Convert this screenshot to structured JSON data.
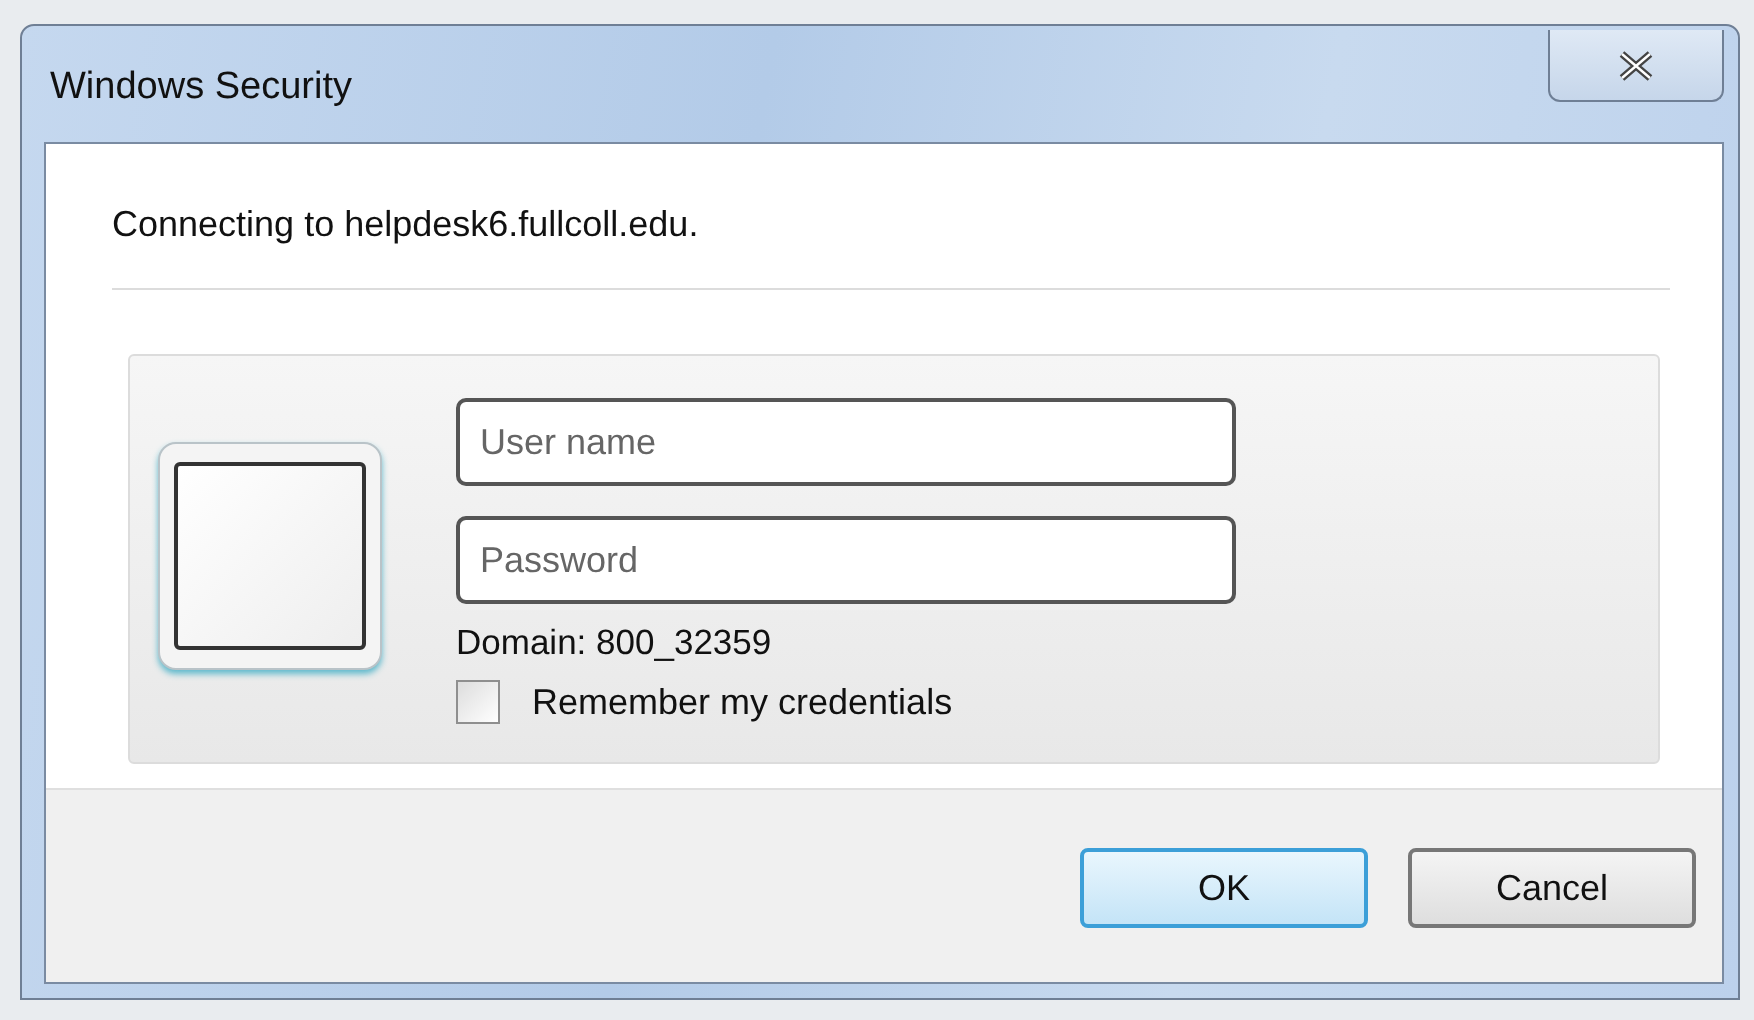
{
  "window": {
    "title": "Windows Security"
  },
  "message": "Connecting to helpdesk6.fullcoll.edu.",
  "credentials": {
    "fields": [
      {
        "placeholder": "User name"
      },
      {
        "placeholder": "Password"
      }
    ],
    "domain": "Domain: 800_32359",
    "remember": {
      "label": "Remember my credentials",
      "checked": false
    }
  },
  "buttons": [
    {
      "label": "OK",
      "default": true
    },
    {
      "label": "Cancel",
      "default": false
    }
  ]
}
